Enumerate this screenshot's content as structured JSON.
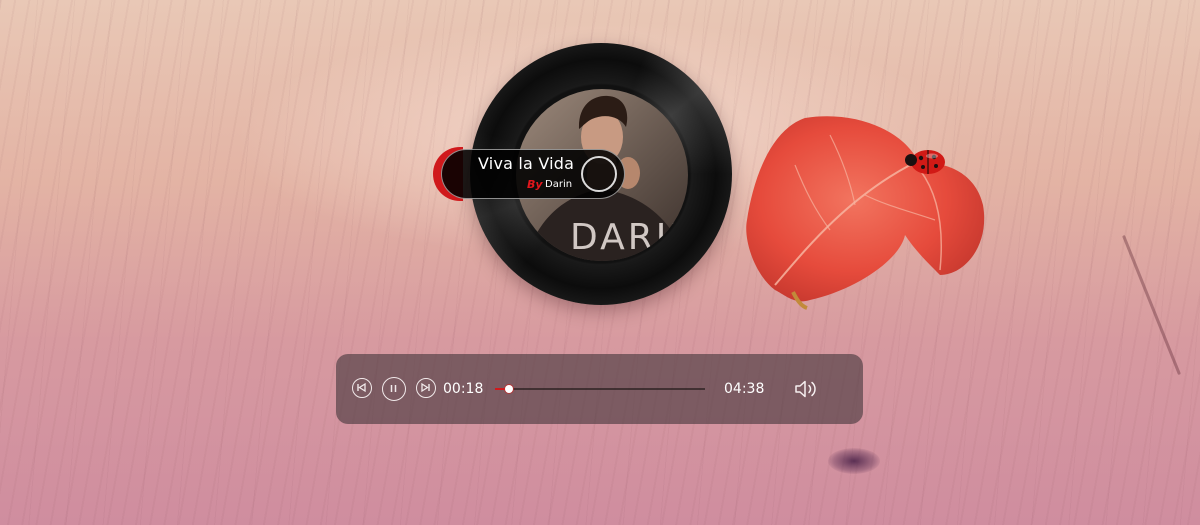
{
  "song": {
    "title": "Viva la Vida",
    "by_label": "By",
    "artist": "Darin",
    "cover_text": "DARIN"
  },
  "player": {
    "current_time": "00:18",
    "total_time": "04:38",
    "progress": 0.065,
    "state": "playing"
  },
  "controls": {
    "prev_icon": "skip-back-icon",
    "pause_icon": "pause-icon",
    "next_icon": "skip-forward-icon",
    "volume_icon": "volume-icon"
  },
  "colors": {
    "accent": "#d0191c",
    "bar_bg": "#463a3c"
  }
}
